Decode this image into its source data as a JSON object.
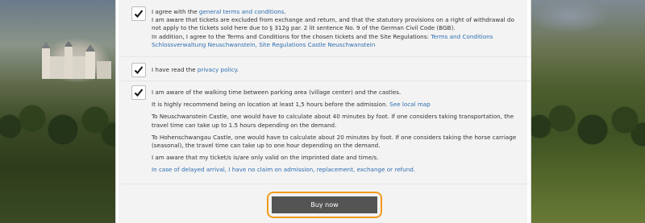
{
  "consents": {
    "terms": {
      "line1_prefix": "I agree with the ",
      "line1_link": "general terms and conditions",
      "line1_suffix": ".",
      "line2": "I am aware that tickets are excluded from exchange and return, and that the statutory provisions on a right of withdrawal do not apply to the tickets sold here due to § 312g par. 2 lit sentence No. 9 of the German Civil Code (BGB).",
      "line3_prefix": "In addition, I agree to the Terms and Conditions for the chosen tickets and the Site Regulations: ",
      "line3_link": "Terms and Conditions Schlossverwaltung Neuschwanstein, Site Regulations Castle Neuschwanstein",
      "checked": true
    },
    "privacy": {
      "prefix": "I have read the ",
      "link": "privacy policy",
      "suffix": ".",
      "checked": true
    },
    "walking": {
      "p1": "I am aware of the walking time between parking area (village center) and the castles.",
      "p2_prefix": "It is highly recommend being on location at least 1,5 hours before the admission. ",
      "p2_link": "See local map",
      "p3": "To Neuschwanstein Castle, one would have to calculate about 40 minutes by foot. If one considers taking transportation, the travel time can take up to 1.5 hours depending on the demand.",
      "p4": "To Hohenschwangau Castle, one would have to calculate about 20 minutes by foot. If one considers taking the horse carriage (seasonal), the travel time can take up to one hour depending on the demand.",
      "p5": "I am aware that my ticket/s is/are only valid on the imprinted date and time/s.",
      "p6": "In case of delayed arrival, I have no claim on admission, replacement, exchange or refund.",
      "checked": true
    }
  },
  "buy_button": {
    "label": "Buy now"
  },
  "colors": {
    "link": "#2e6fb0",
    "button_bg": "#545454",
    "button_focus_ring": "#f39a1c"
  }
}
